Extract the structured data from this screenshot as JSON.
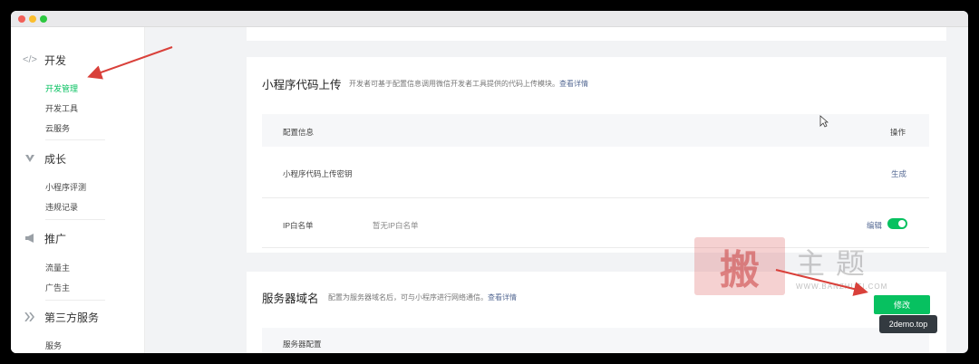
{
  "sidebar": {
    "sections": [
      {
        "icon": "code-icon",
        "title": "开发",
        "items": [
          "开发管理",
          "开发工具",
          "云服务"
        ]
      },
      {
        "icon": "growth-icon",
        "title": "成长",
        "items": [
          "小程序评测",
          "违规记录"
        ]
      },
      {
        "icon": "megaphone-icon",
        "title": "推广",
        "items": [
          "流量主",
          "广告主"
        ]
      },
      {
        "icon": "third-party-icon",
        "title": "第三方服务",
        "items": [
          "服务"
        ]
      }
    ]
  },
  "upload_card": {
    "title": "小程序代码上传",
    "desc": "开发者可基于配置信息调用微信开发者工具提供的代码上传模块。",
    "desc_link": "查看详情",
    "header_config": "配置信息",
    "header_action": "操作",
    "rows": [
      {
        "name": "小程序代码上传密钥",
        "value": "",
        "action": "生成"
      },
      {
        "name": "IP白名单",
        "value": "暂无IP白名单",
        "action": "编辑"
      }
    ]
  },
  "domain_card": {
    "title": "服务器域名",
    "desc": "配置为服务器域名后，可与小程序进行网络通信。",
    "desc_link": "查看详情",
    "edit_button": "修改",
    "header_config": "服务器配置"
  },
  "tooltip": "2demo.top",
  "watermark": {
    "seal": "搬",
    "text": "主题",
    "url": "WWW.BANZHUTI.COM"
  },
  "colors": {
    "accent": "#07c160",
    "link": "#576b95",
    "arrow": "#d9403a"
  }
}
